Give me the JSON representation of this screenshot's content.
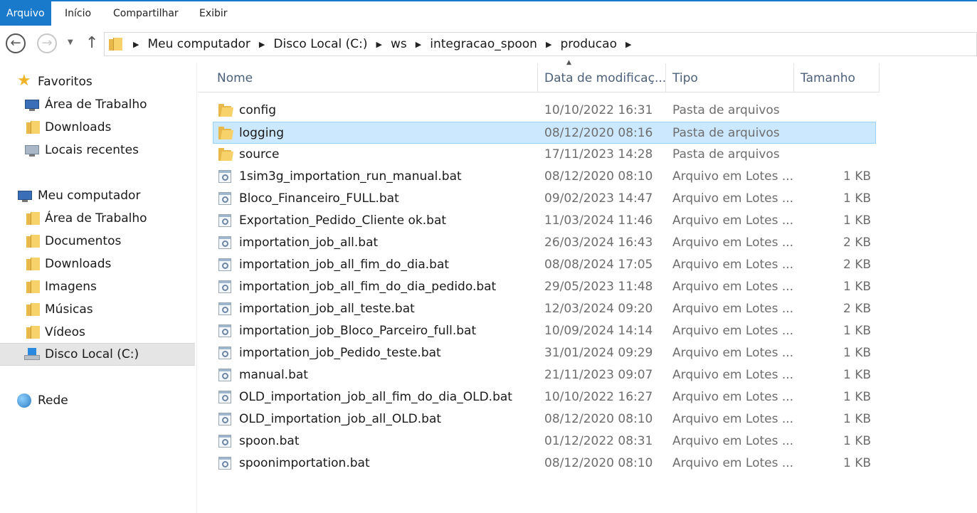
{
  "ribbon": {
    "tabs": [
      "Arquivo",
      "Início",
      "Compartilhar",
      "Exibir"
    ]
  },
  "navigation": {
    "breadcrumbs": [
      "Meu computador",
      "Disco Local (C:)",
      "ws",
      "integracao_spoon",
      "producao"
    ]
  },
  "sidebar": {
    "items": [
      {
        "label": "Favoritos",
        "icon": "star-icon"
      },
      {
        "label": "Área de Trabalho",
        "icon": "desktop-icon"
      },
      {
        "label": "Downloads",
        "icon": "downloads-folder-icon"
      },
      {
        "label": "Locais recentes",
        "icon": "recent-places-icon"
      },
      {
        "label": "Meu computador",
        "icon": "computer-icon"
      },
      {
        "label": "Área de Trabalho",
        "icon": "desktop-folder-icon"
      },
      {
        "label": "Documentos",
        "icon": "documents-folder-icon"
      },
      {
        "label": "Downloads",
        "icon": "downloads-folder-icon"
      },
      {
        "label": "Imagens",
        "icon": "pictures-folder-icon"
      },
      {
        "label": "Músicas",
        "icon": "music-folder-icon"
      },
      {
        "label": "Vídeos",
        "icon": "videos-folder-icon"
      },
      {
        "label": "Disco Local (C:)",
        "icon": "local-disk-icon"
      },
      {
        "label": "Rede",
        "icon": "network-icon"
      }
    ]
  },
  "columns": {
    "name": "Nome",
    "date": "Data de modificaç...",
    "type": "Tipo",
    "size": "Tamanho"
  },
  "files": [
    {
      "name": "config",
      "date": "10/10/2022 16:31",
      "type": "Pasta de arquivos",
      "size": "",
      "kind": "folder"
    },
    {
      "name": "logging",
      "date": "08/12/2020 08:16",
      "type": "Pasta de arquivos",
      "size": "",
      "kind": "folder"
    },
    {
      "name": "source",
      "date": "17/11/2023 14:28",
      "type": "Pasta de arquivos",
      "size": "",
      "kind": "folder"
    },
    {
      "name": "1sim3g_importation_run_manual.bat",
      "date": "08/12/2020 08:10",
      "type": "Arquivo em Lotes ...",
      "size": "1 KB",
      "kind": "bat"
    },
    {
      "name": "Bloco_Financeiro_FULL.bat",
      "date": "09/02/2023 14:47",
      "type": "Arquivo em Lotes ...",
      "size": "1 KB",
      "kind": "bat"
    },
    {
      "name": "Exportation_Pedido_Cliente ok.bat",
      "date": "11/03/2024 11:46",
      "type": "Arquivo em Lotes ...",
      "size": "1 KB",
      "kind": "bat"
    },
    {
      "name": "importation_job_all.bat",
      "date": "26/03/2024 16:43",
      "type": "Arquivo em Lotes ...",
      "size": "2 KB",
      "kind": "bat"
    },
    {
      "name": "importation_job_all_fim_do_dia.bat",
      "date": "08/08/2024 17:05",
      "type": "Arquivo em Lotes ...",
      "size": "2 KB",
      "kind": "bat"
    },
    {
      "name": "importation_job_all_fim_do_dia_pedido.bat",
      "date": "29/05/2023 11:48",
      "type": "Arquivo em Lotes ...",
      "size": "1 KB",
      "kind": "bat"
    },
    {
      "name": "importation_job_all_teste.bat",
      "date": "12/03/2024 09:20",
      "type": "Arquivo em Lotes ...",
      "size": "2 KB",
      "kind": "bat"
    },
    {
      "name": "importation_job_Bloco_Parceiro_full.bat",
      "date": "10/09/2024 14:14",
      "type": "Arquivo em Lotes ...",
      "size": "1 KB",
      "kind": "bat"
    },
    {
      "name": "importation_job_Pedido_teste.bat",
      "date": "31/01/2024 09:29",
      "type": "Arquivo em Lotes ...",
      "size": "1 KB",
      "kind": "bat"
    },
    {
      "name": "manual.bat",
      "date": "21/11/2023 09:07",
      "type": "Arquivo em Lotes ...",
      "size": "1 KB",
      "kind": "bat"
    },
    {
      "name": "OLD_importation_job_all_fim_do_dia_OLD.bat",
      "date": "10/10/2022 16:27",
      "type": "Arquivo em Lotes ...",
      "size": "1 KB",
      "kind": "bat"
    },
    {
      "name": "OLD_importation_job_all_OLD.bat",
      "date": "08/12/2020 08:10",
      "type": "Arquivo em Lotes ...",
      "size": "1 KB",
      "kind": "bat"
    },
    {
      "name": "spoon.bat",
      "date": "01/12/2022 08:31",
      "type": "Arquivo em Lotes ...",
      "size": "1 KB",
      "kind": "bat"
    },
    {
      "name": "spoonimportation.bat",
      "date": "08/12/2020 08:10",
      "type": "Arquivo em Lotes ...",
      "size": "1 KB",
      "kind": "bat"
    }
  ],
  "selected_file": "logging",
  "colors": {
    "accent": "#1979ca",
    "selection": "#cce8ff",
    "selection_border": "#99d1ff"
  }
}
